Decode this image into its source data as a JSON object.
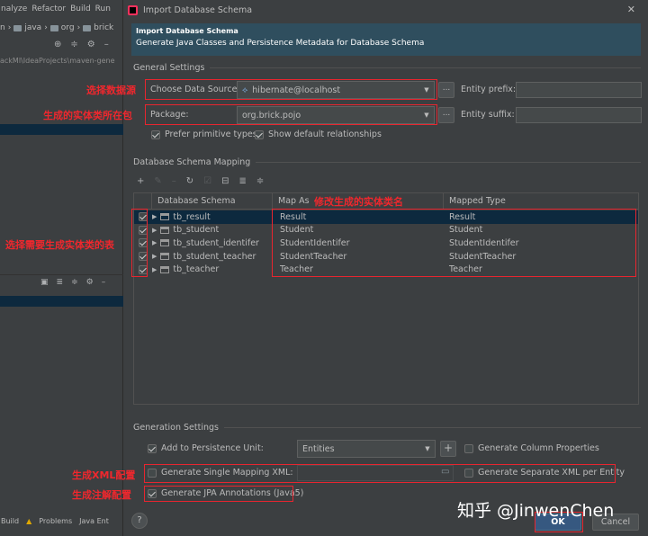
{
  "ide": {
    "menu": [
      "nalyze",
      "Refactor",
      "Build",
      "Run"
    ],
    "breadcrumb": [
      "n",
      "java",
      "org",
      "brick"
    ],
    "project_path": "ackMl\\IdeaProjects\\maven-gene",
    "status_items": [
      "Build",
      "Problems",
      "Java Ent"
    ]
  },
  "dialog": {
    "title": "Import Database Schema",
    "banner_title": "Import Database Schema",
    "banner_subtitle": "Generate Java Classes and Persistence Metadata for Database Schema",
    "general_settings": "General Settings",
    "choose_ds_label": "Choose Data Source:",
    "choose_ds_value": "hibernate@localhost",
    "package_label": "Package:",
    "package_value": "org.brick.pojo",
    "browse_label": "...",
    "entity_prefix_label": "Entity prefix:",
    "entity_suffix_label": "Entity suffix:",
    "prefer_primitive": "Prefer primitive types",
    "show_default_rel": "Show default relationships",
    "mapping_section": "Database Schema Mapping",
    "columns": [
      "Database Schema",
      "Map As",
      "Mapped Type"
    ],
    "rows": [
      {
        "table": "tb_result",
        "map_as": "Result",
        "mapped_type": "Result"
      },
      {
        "table": "tb_student",
        "map_as": "Student",
        "mapped_type": "Student"
      },
      {
        "table": "tb_student_identifer",
        "map_as": "StudentIdentifer",
        "mapped_type": "StudentIdentifer"
      },
      {
        "table": "tb_student_teacher",
        "map_as": "StudentTeacher",
        "mapped_type": "StudentTeacher"
      },
      {
        "table": "tb_teacher",
        "map_as": "Teacher",
        "mapped_type": "Teacher"
      }
    ],
    "generation_settings": "Generation Settings",
    "add_to_pu": "Add to Persistence Unit:",
    "pu_value": "Entities",
    "add_btn": "+",
    "gen_column_props": "Generate Column Properties",
    "gen_single_xml": "Generate Single Mapping XML:",
    "gen_separate_xml": "Generate Separate XML per Entity",
    "gen_jpa": "Generate JPA Annotations (Java5)",
    "ok": "OK",
    "cancel": "Cancel",
    "help": "?"
  },
  "annotations": {
    "choose_ds": "选择数据源",
    "package": "生成的实体类所在包",
    "map_as": "修改生成的实体类名",
    "select_tables": "选择需要生成实体类的表",
    "xml": "生成XML配置",
    "jpa": "生成注解配置"
  },
  "watermark": "知乎 @JinwenChen",
  "colors": {
    "accent_red": "#e8252f",
    "ok_blue": "#365880",
    "banner": "#2f4e5e"
  }
}
